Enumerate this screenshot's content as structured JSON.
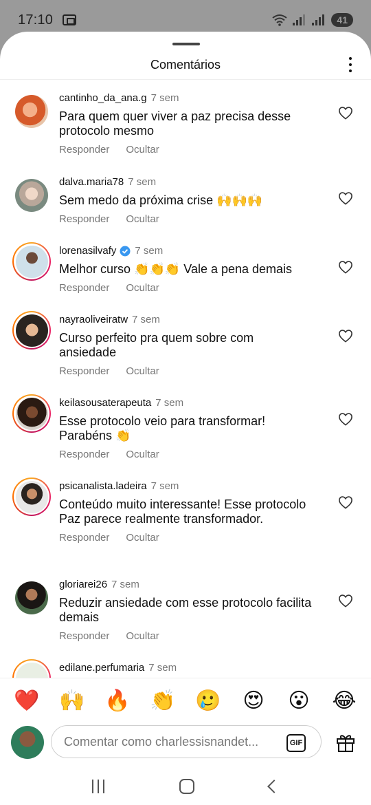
{
  "status_bar": {
    "time": "17:10",
    "battery": "41"
  },
  "header": {
    "title": "Comentários"
  },
  "actions": {
    "reply": "Responder",
    "hide": "Ocultar"
  },
  "comments": [
    {
      "user": "cantinho_da_ana.g",
      "time": "7 sem",
      "text": "Para quem quer viver a paz precisa desse protocolo mesmo",
      "verified": false,
      "story_ring": false
    },
    {
      "user": "dalva.maria78",
      "time": "7 sem",
      "text": "Sem medo da próxima crise 🙌🙌🙌",
      "verified": false,
      "story_ring": false
    },
    {
      "user": "lorenasilvafy",
      "time": "7 sem",
      "text": "Melhor curso 👏👏👏 Vale a pena demais",
      "verified": true,
      "story_ring": true
    },
    {
      "user": "nayraoliveiratw",
      "time": "7 sem",
      "text": "Curso perfeito pra quem sobre com ansiedade",
      "verified": false,
      "story_ring": true
    },
    {
      "user": "keilasousaterapeuta",
      "time": "7 sem",
      "text": "Esse protocolo veio para transformar! Parabéns 👏",
      "verified": false,
      "story_ring": true
    },
    {
      "user": "psicanalista.ladeira",
      "time": "7 sem",
      "text": "Conteúdo muito interessante! Esse protocolo Paz parece realmente transformador.",
      "verified": false,
      "story_ring": true
    },
    {
      "user": "gloriarei26",
      "time": "7 sem",
      "text": "Reduzir ansiedade com esse protocolo facilita demais",
      "verified": false,
      "story_ring": false
    },
    {
      "user": "edilane.perfumaria",
      "time": "7 sem",
      "text": "",
      "verified": false,
      "story_ring": true
    }
  ],
  "emoji_bar": [
    "❤️",
    "🙌",
    "🔥",
    "👏",
    "🥲",
    "😍",
    "😮",
    "😂"
  ],
  "composer": {
    "placeholder": "Comentar como charlessisnandet...",
    "gif_label": "GIF"
  },
  "colors": {
    "accent_verified": "#3897f0",
    "heart_emoji": "#e0245e",
    "muted_text": "#777777"
  }
}
